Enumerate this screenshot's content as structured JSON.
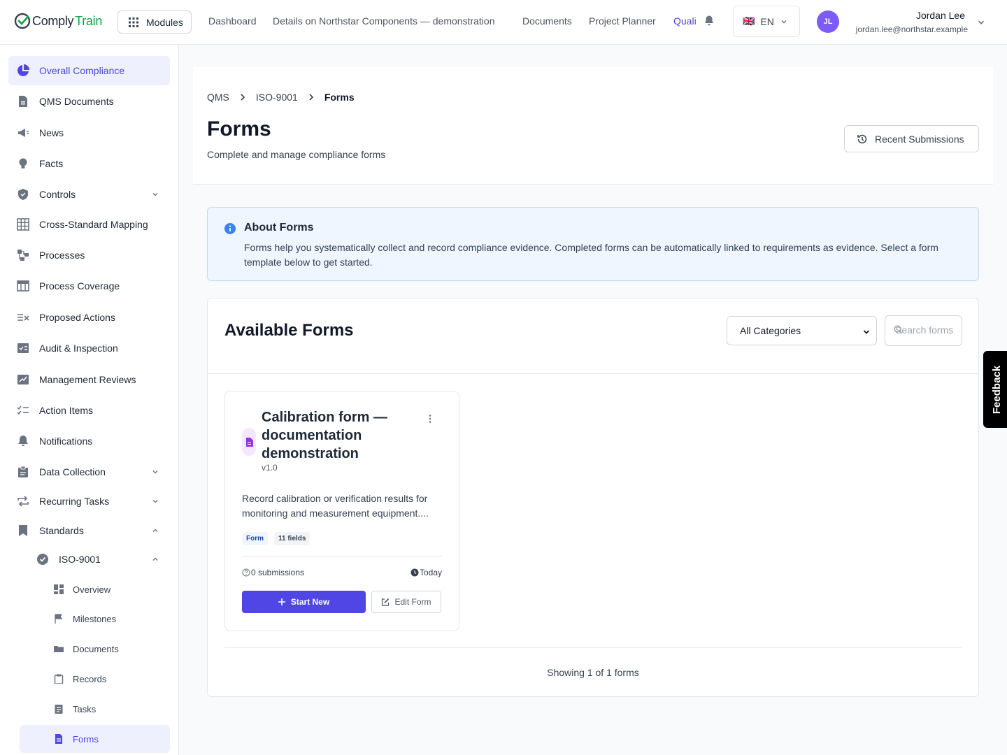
{
  "header": {
    "logo": {
      "part1": "Comply",
      "part2": "Train"
    },
    "modules_label": "Modules",
    "nav": [
      "Dashboard",
      "Details on Northstar Components — demonstration",
      "Documents",
      "Project Planner",
      "Quali"
    ],
    "lang": {
      "flag": "🇬🇧",
      "label": "EN"
    },
    "user": {
      "initials": "JL",
      "name": "Jordan Lee",
      "email": "jordan.lee@northstar.example"
    }
  },
  "sidebar": {
    "items": [
      {
        "label": "Overall Compliance",
        "icon": "pie-chart-icon"
      },
      {
        "label": "QMS Documents",
        "icon": "document-icon"
      },
      {
        "label": "News",
        "icon": "megaphone-icon"
      },
      {
        "label": "Facts",
        "icon": "lightbulb-icon"
      },
      {
        "label": "Controls",
        "icon": "shield-icon"
      },
      {
        "label": "Cross-Standard Mapping",
        "icon": "grid-icon"
      },
      {
        "label": "Processes",
        "icon": "process-icon"
      },
      {
        "label": "Process Coverage",
        "icon": "table-icon"
      },
      {
        "label": "Proposed Actions",
        "icon": "list-check-icon"
      },
      {
        "label": "Audit & Inspection",
        "icon": "audit-icon"
      },
      {
        "label": "Management Reviews",
        "icon": "review-icon"
      },
      {
        "label": "Action Items",
        "icon": "checklist-icon"
      },
      {
        "label": "Notifications",
        "icon": "bell-icon"
      },
      {
        "label": "Data Collection",
        "icon": "clipboard-icon"
      },
      {
        "label": "Recurring Tasks",
        "icon": "repeat-icon"
      },
      {
        "label": "Standards",
        "icon": "bookmark-icon"
      }
    ],
    "standard": {
      "label": "ISO-9001",
      "icon": "badge-check-icon"
    },
    "sub_items": [
      {
        "label": "Overview",
        "icon": "dashboard-icon"
      },
      {
        "label": "Milestones",
        "icon": "flag-icon"
      },
      {
        "label": "Documents",
        "icon": "folder-icon"
      },
      {
        "label": "Records",
        "icon": "clipboard-icon"
      },
      {
        "label": "Tasks",
        "icon": "task-icon"
      },
      {
        "label": "Forms",
        "icon": "form-icon"
      }
    ]
  },
  "breadcrumb": [
    "QMS",
    "ISO-9001",
    "Forms"
  ],
  "page": {
    "title": "Forms",
    "subtitle": "Complete and manage compliance forms",
    "recent_button": "Recent Submissions"
  },
  "about": {
    "title": "About Forms",
    "text": "Forms help you systematically collect and record compliance evidence. Completed forms can be automatically linked to requirements as evidence. Select a form template below to get started."
  },
  "forms": {
    "title": "Available Forms",
    "category_selected": "All Categories",
    "search_placeholder": "Search forms",
    "cards": [
      {
        "title": "Calibration form — documentation demonstration",
        "version": "v1.0",
        "description": "Record calibration or verification results for monitoring and measurement equipment....",
        "type_badge": "Form",
        "fields_badge": "11 fields",
        "submissions": "0 submissions",
        "date": "Today",
        "start_label": "Start New",
        "edit_label": "Edit Form"
      }
    ],
    "showing": "Showing 1 of 1 forms"
  },
  "feedback_label": "Feedback",
  "colors": {
    "accent": "#4f46e5",
    "brand_green": "#16a34a",
    "info_bg": "#eff6ff",
    "avatar": "#7c5cf5"
  }
}
